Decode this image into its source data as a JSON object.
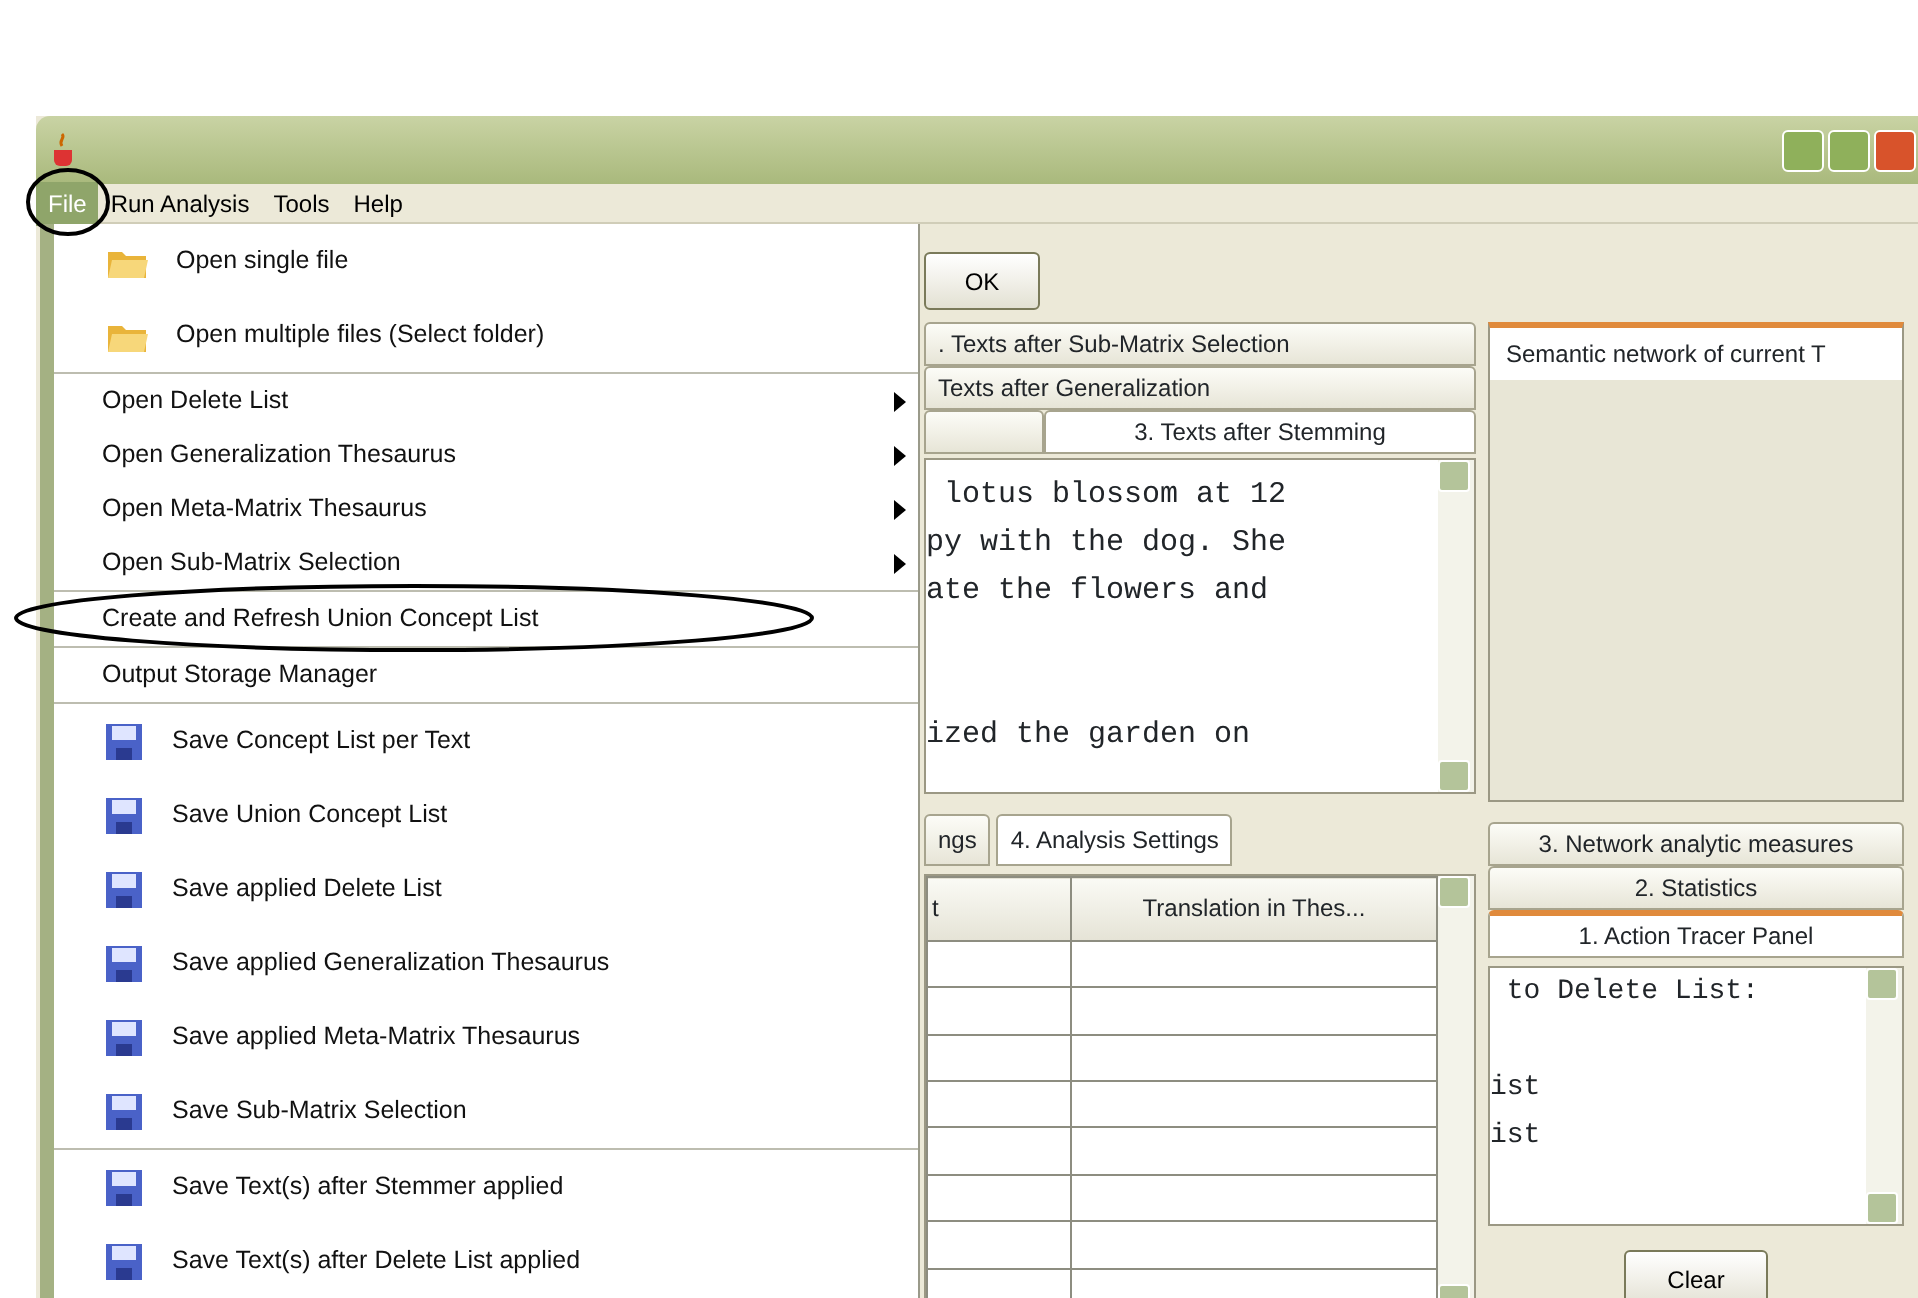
{
  "menu_bar": [
    {
      "label": "File",
      "selected": true
    },
    {
      "label": "Run Analysis",
      "selected": false
    },
    {
      "label": "Tools",
      "selected": false
    },
    {
      "label": "Help",
      "selected": false
    }
  ],
  "file_menu": [
    [
      {
        "kind": "open",
        "label": "Open single file"
      },
      {
        "kind": "open",
        "label": "Open multiple files (Select folder)"
      }
    ],
    [
      {
        "kind": "submenu",
        "label": "Open Delete List"
      },
      {
        "kind": "submenu",
        "label": "Open Generalization Thesaurus"
      },
      {
        "kind": "submenu",
        "label": "Open Meta-Matrix Thesaurus"
      },
      {
        "kind": "submenu",
        "label": "Open Sub-Matrix Selection"
      }
    ],
    [
      {
        "kind": "command",
        "label": "Create and Refresh Union Concept List"
      }
    ],
    [
      {
        "kind": "command",
        "label": "Output Storage Manager"
      }
    ],
    [
      {
        "kind": "save",
        "label": "Save Concept List per Text"
      },
      {
        "kind": "save",
        "label": "Save Union Concept List"
      },
      {
        "kind": "save",
        "label": "Save applied Delete List"
      },
      {
        "kind": "save",
        "label": "Save applied Generalization Thesaurus"
      },
      {
        "kind": "save",
        "label": "Save applied Meta-Matrix Thesaurus"
      },
      {
        "kind": "save",
        "label": "Save Sub-Matrix Selection"
      }
    ],
    [
      {
        "kind": "save",
        "label": "Save Text(s) after Stemmer applied"
      },
      {
        "kind": "save",
        "label": "Save Text(s) after Delete List applied"
      }
    ]
  ],
  "ok_button": "OK",
  "text_tabs": [
    [
      {
        "label": ". Texts after Sub-Matrix Selection",
        "selected": false
      }
    ],
    [
      {
        "label": "Texts after Generalization",
        "selected": false
      }
    ],
    [
      {
        "label": "3. Texts after Stemming",
        "selected": true
      }
    ]
  ],
  "text_content": " lotus blossom at 12\npy with the dog. She\nate the flowers and\n\n\nized the garden on",
  "settings_tabs": [
    {
      "label": "ngs",
      "selected": false
    },
    {
      "label": "4. Analysis Settings",
      "selected": true
    }
  ],
  "table": {
    "columns": [
      "t",
      "Translation in Thes..."
    ]
  },
  "network_panel": {
    "title": "Semantic network of current T"
  },
  "side_tabs": [
    {
      "label": "3. Network analytic measures",
      "selected": false
    },
    {
      "label": "2. Statistics",
      "selected": false
    },
    {
      "label": "1. Action Tracer Panel",
      "selected": true
    }
  ],
  "tracer_text": " to Delete List:\n\nist\nist",
  "clear_button": "Clear"
}
